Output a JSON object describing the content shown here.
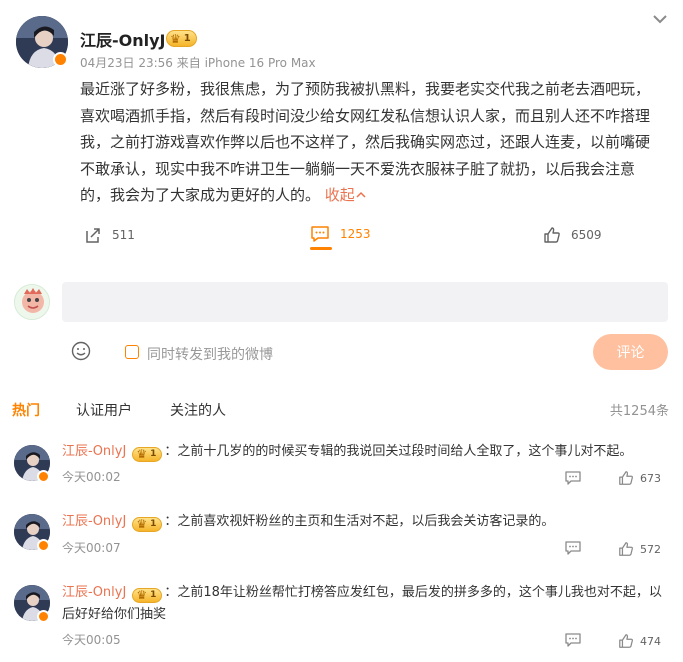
{
  "post": {
    "author": "江辰-OnlyJ",
    "badge_level": "1",
    "meta": "04月23日 23:56  来自 iPhone 16 Pro Max",
    "body": "最近涨了好多粉，我很焦虑，为了预防我被扒黑料，我要老实交代我之前老去酒吧玩，喜欢喝酒抓手指，然后有段时间没少给女网红发私信想认识人家，而且别人还不咋搭理我，之前打游戏喜欢作弊以后也不这样了，然后我确实网恋过，还跟人连麦，以前嘴硬不敢承认，现实中我不咋讲卫生一躺躺一天不爱洗衣服袜子脏了就扔，以后我会注意的，我会为了大家成为更好的人的。",
    "collapse_label": "收起",
    "reposts": "511",
    "comments": "1253",
    "likes": "6509"
  },
  "compose": {
    "placeholder": "",
    "share_label": "同时转发到我的微博",
    "submit_label": "评论"
  },
  "tabs": [
    {
      "label": "热门"
    },
    {
      "label": "认证用户"
    },
    {
      "label": "关注的人"
    }
  ],
  "comment_count": "共1254条",
  "comments": [
    {
      "name": "江辰-OnlyJ",
      "badge_level": "1",
      "text": "：之前十几岁的的时候买专辑的我说回关过段时间给人全取了，这个事儿对不起。",
      "time": "今天00:02",
      "likes": "673"
    },
    {
      "name": "江辰-OnlyJ",
      "badge_level": "1",
      "text": "：之前喜欢视奸粉丝的主页和生活对不起，以后我会关访客记录的。",
      "time": "今天00:07",
      "likes": "572"
    },
    {
      "name": "江辰-OnlyJ",
      "badge_level": "1",
      "text": "：之前18年让粉丝帮忙打榜答应发红包，最后发的拼多多的，这个事儿我也对不起，以后好好给你们抽奖",
      "time": "今天00:05",
      "likes": "474"
    }
  ],
  "icons": {
    "expand": "chevron-down-icon",
    "repost": "repost-icon",
    "comment": "comment-icon",
    "like": "thumbs-up-icon",
    "emoji": "smiley-icon"
  },
  "colors": {
    "accent": "#ff8200",
    "link": "#eb7350",
    "submit_disabled": "#ffc09f"
  }
}
